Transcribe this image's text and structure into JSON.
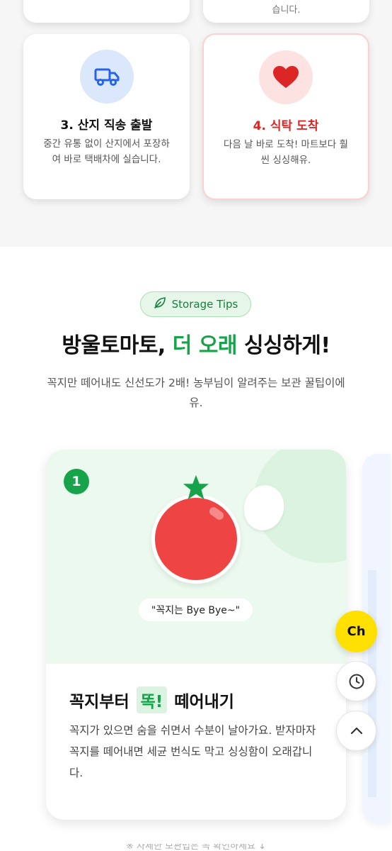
{
  "steps": {
    "top_right_desc_tail": "습니다.",
    "step3": {
      "title": "3. 산지 직송 출발",
      "desc": "중간 유통 없이 산지에서 포장하여 바로 택배차에 실습니다.",
      "icon": "truck-icon",
      "icon_bg": "#dbe8fb",
      "icon_color": "#2563eb"
    },
    "step4": {
      "title": "4. 식탁 도착",
      "desc": "다음 날 바로 도착! 마트보다 훨씬 싱싱해유.",
      "icon": "heart-icon",
      "icon_bg": "#fde2e2",
      "icon_color": "#dc2626"
    }
  },
  "tips": {
    "pill_label": "Storage Tips",
    "pill_icon": "leaf-icon",
    "headline_pre": "방울토마토,",
    "headline_accent": "더 오래",
    "headline_post": "싱싱하게!",
    "subtitle": "꼭지만 떼어내도 신선도가 2배! 농부님이 알려주는 보관 꿀팁이에유."
  },
  "tip_card": {
    "number": "1",
    "bubble": "\"꼭지는 Bye Bye~\"",
    "heading_pre": "꼭지부터",
    "heading_accent": "똑!",
    "heading_post": "떼어내기",
    "body": "꼭지가 있으면 숨을 쉬면서 수분이 날아가요. 받자마자 꼭지를 떼어내면 세균 번식도 막고 싱싱함이 오래갑니다."
  },
  "floating": {
    "channel_label": "Ch",
    "recent_icon": "clock-icon",
    "top_icon": "chevron-up-icon"
  },
  "bottom_note": "※ 자세한 보관법은 꼭 확인하세요 ↓",
  "colors": {
    "accent_green": "#16a34a",
    "accent_red": "#dc2626",
    "channel_yellow": "#ffe000"
  }
}
